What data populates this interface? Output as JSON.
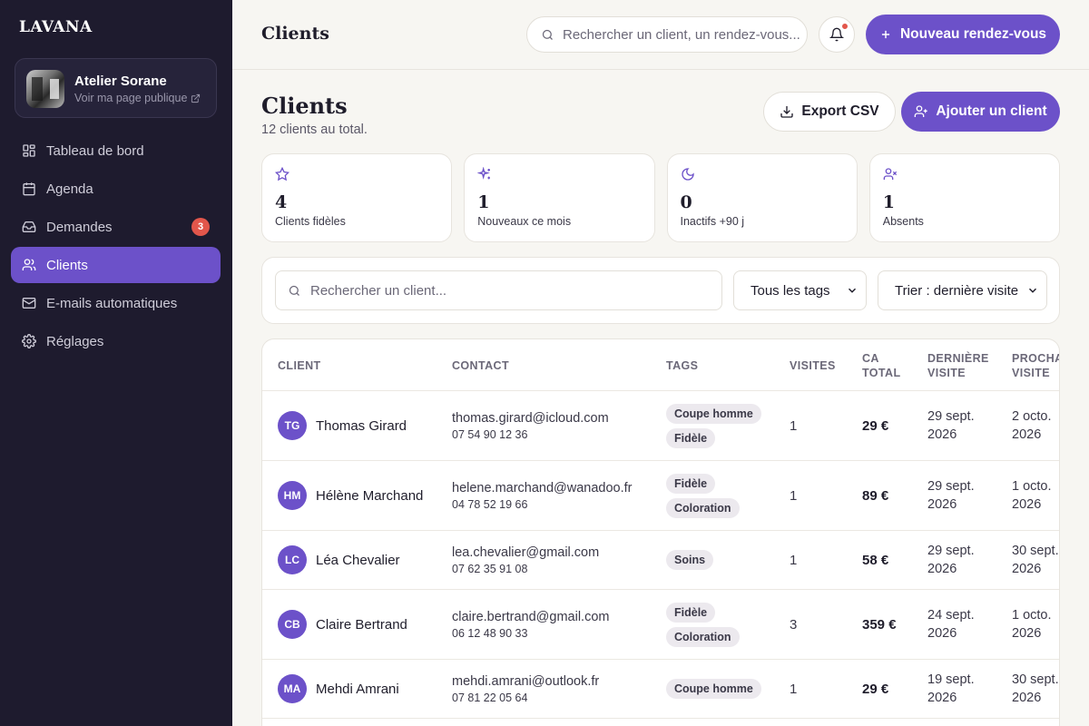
{
  "sidebar": {
    "logo": "LAVANA",
    "studio": {
      "name": "Atelier Sorane",
      "link": "Voir ma page publique"
    },
    "items": [
      {
        "label": "Tableau de bord",
        "icon": "dashboard-icon"
      },
      {
        "label": "Agenda",
        "icon": "calendar-icon"
      },
      {
        "label": "Demandes",
        "icon": "inbox-icon",
        "badge": "3"
      },
      {
        "label": "Clients",
        "icon": "users-icon",
        "active": true
      },
      {
        "label": "E-mails automatiques",
        "icon": "mail-icon"
      },
      {
        "label": "Réglages",
        "icon": "gear-icon"
      }
    ]
  },
  "topbar": {
    "title": "Clients",
    "search_placeholder": "Rechercher un client, un rendez-vous...",
    "new_button": "Nouveau rendez-vous"
  },
  "page": {
    "title": "Clients",
    "subtitle": "12 clients au total.",
    "export_button": "Export CSV",
    "add_button": "Ajouter un client"
  },
  "stats": [
    {
      "value": "4",
      "label": "Clients fidèles",
      "icon": "star-icon"
    },
    {
      "value": "1",
      "label": "Nouveaux ce mois",
      "icon": "sparkles-icon"
    },
    {
      "value": "0",
      "label": "Inactifs +90 j",
      "icon": "moon-icon"
    },
    {
      "value": "1",
      "label": "Absents",
      "icon": "user-x-icon"
    }
  ],
  "filters": {
    "search_placeholder": "Rechercher un client...",
    "tags_select": "Tous les tags",
    "sort_select": "Trier : dernière visite"
  },
  "table": {
    "headers": {
      "client": "Client",
      "contact": "Contact",
      "tags": "Tags",
      "visits": "Visites",
      "ca_line1": "CA",
      "ca_line2": "Total",
      "last_line1": "Dernière",
      "last_line2": "visite",
      "next_line1": "Prochaine",
      "next_line2": "visite"
    },
    "rows": [
      {
        "initials": "TG",
        "name": "Thomas Girard",
        "email": "thomas.girard@icloud.com",
        "phone": "07 54 90 12 36",
        "tags": [
          "Coupe homme",
          "Fidèle"
        ],
        "visits": "1",
        "ca": "29 €",
        "last_1": "29 sept.",
        "last_2": "2026",
        "next_1": "2 octo.",
        "next_2": "2026"
      },
      {
        "initials": "HM",
        "name": "Hélène Marchand",
        "email": "helene.marchand@wanadoo.fr",
        "phone": "04 78 52 19 66",
        "tags": [
          "Fidèle",
          "Coloration"
        ],
        "visits": "1",
        "ca": "89 €",
        "last_1": "29 sept.",
        "last_2": "2026",
        "next_1": "1 octo.",
        "next_2": "2026"
      },
      {
        "initials": "LC",
        "name": "Léa Chevalier",
        "email": "lea.chevalier@gmail.com",
        "phone": "07 62 35 91 08",
        "tags": [
          "Soins"
        ],
        "visits": "1",
        "ca": "58 €",
        "last_1": "29 sept.",
        "last_2": "2026",
        "next_1": "30 sept.",
        "next_2": "2026"
      },
      {
        "initials": "CB",
        "name": "Claire Bertrand",
        "email": "claire.bertrand@gmail.com",
        "phone": "06 12 48 90 33",
        "tags": [
          "Fidèle",
          "Coloration"
        ],
        "visits": "3",
        "ca": "359 €",
        "last_1": "24 sept.",
        "last_2": "2026",
        "next_1": "1 octo.",
        "next_2": "2026"
      },
      {
        "initials": "MA",
        "name": "Mehdi Amrani",
        "email": "mehdi.amrani@outlook.fr",
        "phone": "07 81 22 05 64",
        "tags": [
          "Coupe homme"
        ],
        "visits": "1",
        "ca": "29 €",
        "last_1": "19 sept.",
        "last_2": "2026",
        "next_1": "30 sept.",
        "next_2": "2026"
      }
    ]
  },
  "colors": {
    "accent": "#6c51c9",
    "sidebar": "#1e1b2e",
    "badge": "#e2564b"
  }
}
